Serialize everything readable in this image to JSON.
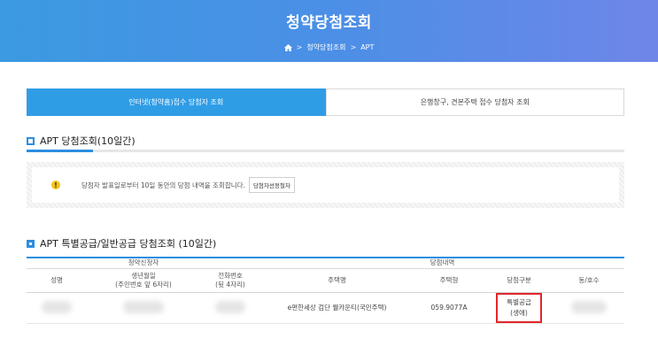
{
  "banner": {
    "title": "청약당첨조회",
    "breadcrumb": [
      "청약당첨조회",
      "APT"
    ],
    "sep": ">"
  },
  "tabs": [
    {
      "label": "인터넷(청약홈)접수 당첨자 조회",
      "active": true
    },
    {
      "label": "은행창구, 견본주택 접수 당첨자 조회",
      "active": false
    }
  ],
  "section1": {
    "title": "APT 당첨조회(10일간)",
    "notice_text": "당첨자 발표일로부터 10일 동안의 당첨 내역을 조회합니다.",
    "notice_button": "당첨자선정절차"
  },
  "section2": {
    "title": "APT 특별공급/일반공급 당첨조회 (10일간)",
    "group_headers": [
      "청약신청자",
      "당첨내역"
    ],
    "columns": [
      {
        "line1": "성명",
        "line2": ""
      },
      {
        "line1": "생년월일",
        "line2": "(주민번호 앞 6자리)"
      },
      {
        "line1": "전화번호",
        "line2": "(뒷 4자리)"
      },
      {
        "line1": "주택명",
        "line2": ""
      },
      {
        "line1": "주택형",
        "line2": ""
      },
      {
        "line1": "당첨구분",
        "line2": ""
      },
      {
        "line1": "동/호수",
        "line2": ""
      }
    ],
    "row": {
      "house_name": "e편한세상 검단 웰카운티(국민주택)",
      "house_type": "059.9077A",
      "win_type_line1": "특별공급",
      "win_type_line2": "(생애)"
    }
  },
  "colors": {
    "accent": "#2a8ee0",
    "tab_active": "#2f9de6",
    "highlight": "#e3262b",
    "warning": "#f3c318"
  }
}
